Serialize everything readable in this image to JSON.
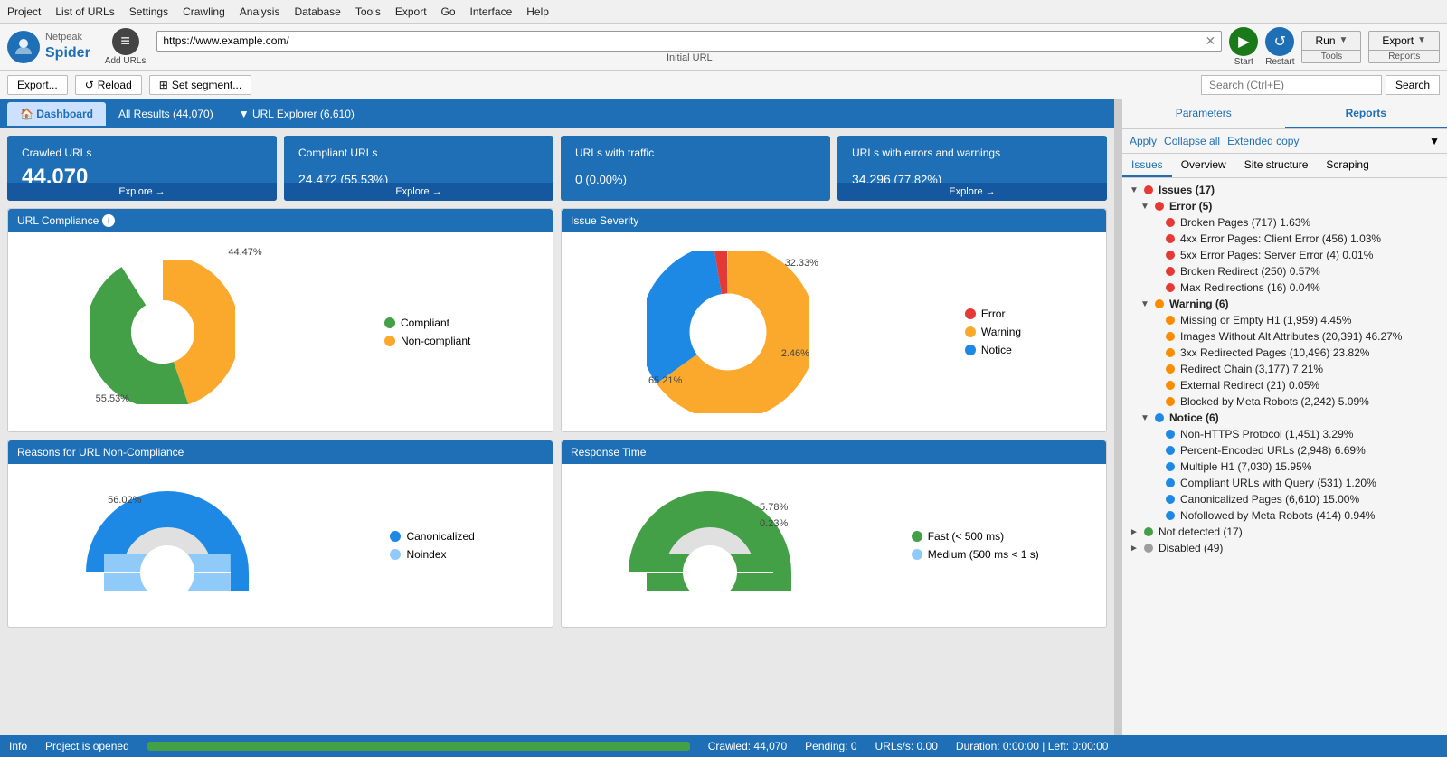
{
  "menu": {
    "items": [
      "Project",
      "List of URLs",
      "Settings",
      "Crawling",
      "Analysis",
      "Database",
      "Tools",
      "Export",
      "Go",
      "Interface",
      "Help"
    ]
  },
  "toolbar": {
    "logo_net": "Netpeak",
    "logo_spider": "Spider",
    "add_urls_label": "Add URLs",
    "url_value": "https://www.example.com/",
    "url_label": "Initial URL",
    "start_label": "Start",
    "restart_label": "Restart",
    "run_label": "Run",
    "tools_label": "Tools",
    "export_label": "Export",
    "reports_label": "Reports"
  },
  "action_bar": {
    "export_label": "Export...",
    "reload_label": "Reload",
    "segment_label": "Set segment...",
    "search_placeholder": "Search (Ctrl+E)",
    "search_btn": "Search"
  },
  "tabs": {
    "dashboard": "Dashboard",
    "all_results": "All Results (44,070)",
    "url_explorer": "URL Explorer (6,610)"
  },
  "stats": [
    {
      "title": "Crawled URLs",
      "value": "44,070",
      "sub": "",
      "explore": "Explore →"
    },
    {
      "title": "Compliant URLs",
      "value": "24,472",
      "sub": " (55.53%)",
      "explore": "Explore →"
    },
    {
      "title": "URLs with traffic",
      "value": "0",
      "sub": " (0.00%)",
      "explore": ""
    },
    {
      "title": "URLs with errors and warnings",
      "value": "34,296",
      "sub": " (77.82%)",
      "explore": "Explore →"
    }
  ],
  "url_compliance": {
    "title": "URL Compliance",
    "pct_noncompliant": "44.47%",
    "pct_compliant": "55.53%",
    "legend": [
      {
        "color": "#43a047",
        "label": "Compliant"
      },
      {
        "color": "#fba92c",
        "label": "Non-compliant"
      }
    ]
  },
  "issue_severity": {
    "title": "Issue Severity",
    "pct_notice": "32.33%",
    "pct_warning": "65.21%",
    "pct_error": "2.46%",
    "legend": [
      {
        "color": "#e53935",
        "label": "Error"
      },
      {
        "color": "#fba92c",
        "label": "Warning"
      },
      {
        "color": "#1e88e5",
        "label": "Notice"
      }
    ]
  },
  "non_compliance": {
    "title": "Reasons for URL Non-Compliance",
    "pct": "56.02%",
    "legend": [
      {
        "color": "#1e88e5",
        "label": "Canonicalized"
      },
      {
        "color": "#90caf9",
        "label": "Noindex"
      }
    ]
  },
  "response_time": {
    "title": "Response Time",
    "pct1": "5.78%",
    "pct2": "0.23%",
    "legend": [
      {
        "color": "#43a047",
        "label": "Fast (< 500 ms)"
      },
      {
        "color": "#90caf9",
        "label": "Medium (500 ms < 1 s)"
      }
    ]
  },
  "right_panel": {
    "tabs": [
      "Parameters",
      "Reports"
    ],
    "active_tab": "Reports",
    "actions": [
      "Apply",
      "Collapse all",
      "Extended copy"
    ],
    "issues_tabs": [
      "Issues",
      "Overview",
      "Site structure",
      "Scraping"
    ],
    "active_issues_tab": "Issues"
  },
  "tree": {
    "items": [
      {
        "level": 0,
        "expand": "▼",
        "dot": "red",
        "label": "Issues (17)",
        "bold": true
      },
      {
        "level": 1,
        "expand": "▼",
        "dot": "red",
        "label": "Error (5)",
        "bold": true
      },
      {
        "level": 2,
        "expand": "",
        "dot": "red",
        "label": "Broken Pages (717) 1.63%"
      },
      {
        "level": 2,
        "expand": "",
        "dot": "red",
        "label": "4xx Error Pages: Client Error (456) 1.03%"
      },
      {
        "level": 2,
        "expand": "",
        "dot": "red",
        "label": "5xx Error Pages: Server Error (4) 0.01%"
      },
      {
        "level": 2,
        "expand": "",
        "dot": "red",
        "label": "Broken Redirect (250) 0.57%"
      },
      {
        "level": 2,
        "expand": "",
        "dot": "red",
        "label": "Max Redirections (16) 0.04%"
      },
      {
        "level": 1,
        "expand": "▼",
        "dot": "orange",
        "label": "Warning (6)",
        "bold": true
      },
      {
        "level": 2,
        "expand": "",
        "dot": "orange",
        "label": "Missing or Empty H1 (1,959) 4.45%"
      },
      {
        "level": 2,
        "expand": "",
        "dot": "orange",
        "label": "Images Without Alt Attributes (20,391) 46.27%"
      },
      {
        "level": 2,
        "expand": "",
        "dot": "orange",
        "label": "3xx Redirected Pages (10,496) 23.82%"
      },
      {
        "level": 2,
        "expand": "",
        "dot": "orange",
        "label": "Redirect Chain (3,177) 7.21%"
      },
      {
        "level": 2,
        "expand": "",
        "dot": "orange",
        "label": "External Redirect (21) 0.05%"
      },
      {
        "level": 2,
        "expand": "",
        "dot": "orange",
        "label": "Blocked by Meta Robots (2,242) 5.09%"
      },
      {
        "level": 1,
        "expand": "▼",
        "dot": "blue",
        "label": "Notice (6)",
        "bold": true
      },
      {
        "level": 2,
        "expand": "",
        "dot": "blue",
        "label": "Non-HTTPS Protocol (1,451) 3.29%"
      },
      {
        "level": 2,
        "expand": "",
        "dot": "blue",
        "label": "Percent-Encoded URLs (2,948) 6.69%"
      },
      {
        "level": 2,
        "expand": "",
        "dot": "blue",
        "label": "Multiple H1 (7,030) 15.95%"
      },
      {
        "level": 2,
        "expand": "",
        "dot": "blue",
        "label": "Compliant URLs with Query (531) 1.20%"
      },
      {
        "level": 2,
        "expand": "",
        "dot": "blue",
        "label": "Canonicalized Pages (6,610) 15.00%"
      },
      {
        "level": 2,
        "expand": "",
        "dot": "blue",
        "label": "Nofollowed by Meta Robots (414) 0.94%"
      },
      {
        "level": 0,
        "expand": "►",
        "dot": "green",
        "label": "Not detected (17)",
        "bold": false
      },
      {
        "level": 0,
        "expand": "►",
        "dot": "gray",
        "label": "Disabled (49)",
        "bold": false
      }
    ]
  },
  "status_bar": {
    "info": "Info",
    "project_status": "Project is opened",
    "progress": 100,
    "crawled": "Crawled: 44,070",
    "pending": "Pending: 0",
    "urls_per_sec": "URLs/s: 0.00",
    "duration": "Duration: 0:00:00 | Left: 0:00:00"
  }
}
